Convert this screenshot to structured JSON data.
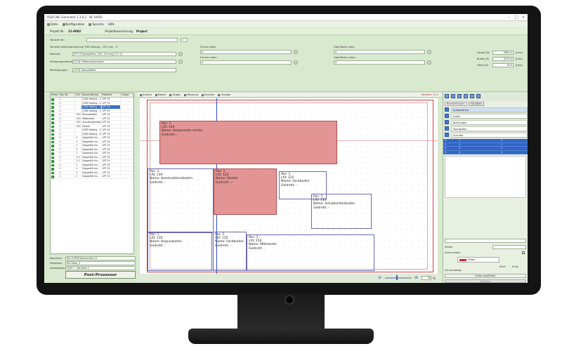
{
  "window": {
    "title": "OSD-CNC-Generator 1.3.0.2 - NC-HOPS"
  },
  "menu": [
    "Datei",
    "Konfiguration",
    "Sprache",
    "Hilfe"
  ],
  "project": {
    "no_label": "Projekt Nr.:",
    "no": "21-0002",
    "name_label": "Projektbezeichnung:",
    "name": "Project"
  },
  "form": {
    "variant_label": "Variante Nr.:",
    "variant_value": "1",
    "description": "Variante Außenabmessung: OSD Vesting - 19-0 mm - 4",
    "material_label": "Material:",
    "material": "[FP 19 Spanplatte, V20, 19 mm] [3 x 2]",
    "fertigung_label": "Fertigungsmethode:",
    "fertigung": "[110] Plattenmaterialien",
    "rohteil_label": "Rohteilgruppe:",
    "rohteil": "[110] Spanplatten",
    "furnier_oben_label": "Furnier oben:",
    "furnier_oben": "A",
    "furnier_unten_label": "Furnier unten:",
    "furnier_unten": "A",
    "oberflaeche_oben_label": "Oberfläche oben:",
    "oberflaeche_oben": "A",
    "oberflaeche_unten_label": "Oberfläche unten:",
    "oberflaeche_unten": "A",
    "laenge_label": "Länge [X]:",
    "laenge": "2890.0",
    "laenge_unit": "[mm]",
    "breite_label": "Breite [Y]:",
    "breite": "2070.0",
    "breite_unit": "[mm]",
    "hoehe_label": "Höhe [Z]:",
    "hoehe": "19.0",
    "hoehe_unit": "[mm]"
  },
  "parts_table": {
    "columns": [
      "Pomo",
      "Pos.-Nr.",
      "Lfd",
      "Beschreibung",
      "Material",
      "Länge"
    ],
    "rows": [
      {
        "pos": "1",
        "lfd": "",
        "desc": "[OSD Vesting - 19...",
        "mat": "LFP 19",
        "sel": false
      },
      {
        "pos": "1",
        "lfd": "",
        "desc": "[OSD Vesting - 19...",
        "mat": "LFP 19",
        "sel": false
      },
      {
        "pos": "1",
        "lfd": "",
        "desc": "[OSD Vesting - 19...",
        "mat": "LFP 19",
        "sel": true
      },
      {
        "pos": "1",
        "lfd": "",
        "desc": "[OSD Vesting - 19...",
        "mat": "LFP 19",
        "sel": false
      },
      {
        "pos": "1",
        "lfd": "120",
        "desc": "Korpusboden",
        "mat": "LFP 19",
        "sel": false
      },
      {
        "pos": "1",
        "lfd": "130",
        "desc": "Mittelseite",
        "mat": "LFP 19",
        "sel": false
      },
      {
        "pos": "1",
        "lfd": "135",
        "desc": "Schubkastenboden",
        "mat": "LFP 19",
        "sel": false
      },
      {
        "pos": "1",
        "lfd": "140",
        "desc": "Deckel",
        "mat": "LFP 19",
        "sel": false
      },
      {
        "pos": "1",
        "lfd": "",
        "desc": "[OSD Vesting - 19...",
        "mat": "LFP 19",
        "sel": false
      },
      {
        "pos": "1",
        "lfd": "",
        "desc": "[OSD Vesting - 19...",
        "mat": "LFP 19",
        "sel": false
      },
      {
        "pos": "1",
        "lfd": "1",
        "desc": "Doppeltür Ins...",
        "mat": "LFP 19",
        "sel": false
      },
      {
        "pos": "1",
        "lfd": "1",
        "desc": "Doppeltür Ins...",
        "mat": "LFP 19",
        "sel": false
      },
      {
        "pos": "1",
        "lfd": "1",
        "desc": "Doppeltür Ins...",
        "mat": "LFP 19",
        "sel": false
      },
      {
        "pos": "1",
        "lfd": "1",
        "desc": "Doppeltür Ins...",
        "mat": "LFP 19",
        "sel": false
      },
      {
        "pos": "1",
        "lfd": "1",
        "desc": "Doppeltür Ins...",
        "mat": "LFP 19",
        "sel": false
      },
      {
        "pos": "1",
        "lfd": "1.1",
        "desc": "Doppeltür Ins...",
        "mat": "LFP 19",
        "sel": false
      },
      {
        "pos": "1",
        "lfd": "1.1",
        "desc": "Doppeltür Ins...",
        "mat": "LFP 19",
        "sel": false
      },
      {
        "pos": "1",
        "lfd": "1",
        "desc": "Doppeltür Ins...",
        "mat": "LFP 19",
        "sel": false
      },
      {
        "pos": "1",
        "lfd": "1",
        "desc": "Doppeltür Ins...",
        "mat": "LFP 19",
        "sel": false
      },
      {
        "pos": "1",
        "lfd": "1",
        "desc": "Doppeltür Ins...",
        "mat": "LFP 19",
        "sel": false
      },
      {
        "pos": "1",
        "lfd": "1",
        "desc": "Doppeltür Ins...",
        "mat": "LFP 19",
        "sel": false
      }
    ]
  },
  "bottom": {
    "maschine_label": "Maschine:",
    "maschine": "NC-HOPS/Heinzmühle 21",
    "prozessor_label": "Prozessor:",
    "prozessor": "NC-Hops_3",
    "arbeitsplatz_label": "Arbeitsplatz:",
    "arbeitsplatz": "Feld 1 - Variante 1",
    "post_button": "Post-Prozessor"
  },
  "toolbar": [
    "Ansicht",
    "Raster",
    "Zeigen",
    "Messung",
    "Drucken",
    "Anzeige"
  ],
  "canvas": {
    "status": "Gedreht: 10.4",
    "parts": [
      {
        "pos": "Pos: 1",
        "lfd": "Lfd: 140",
        "name": "Name: Korpusseite rechts",
        "gedreht": "Gedreht: -",
        "hl": true
      },
      {
        "pos": "Pos: 1",
        "lfd": "Lfd: 130",
        "name": "Name: Konstruktionsboden",
        "gedreht": "Gedreht: -",
        "hl": false
      },
      {
        "pos": "Pos: 1",
        "lfd": "Lfd: 120",
        "name": "Name: Deckel",
        "gedreht": "Gedreht: ✓",
        "hl": true
      },
      {
        "pos": "Pos: 1",
        "lfd": "Lfd: 125",
        "name": "Name: Fachboden",
        "gedreht": "Gedreht: -",
        "hl": false
      },
      {
        "pos": "Pos: 1",
        "lfd": "Lfd: 135",
        "name": "Name: Schubkastenboden",
        "gedreht": "Gedreht: -",
        "hl": false
      },
      {
        "pos": "Pos: 1",
        "lfd": "Lfd: 135",
        "name": "Name: Korpusboden",
        "gedreht": "Gedreht: -",
        "hl": false
      },
      {
        "pos": "Pos: 1",
        "lfd": "Lfd: 125",
        "name": "Name: Fachboden",
        "gedreht": "Gedreht: -",
        "hl": false
      },
      {
        "pos": "Pos: 1",
        "lfd": "Lfd: 150",
        "name": "Name: Mittelseite",
        "gedreht": "Gedreht: -",
        "hl": false
      }
    ],
    "zoom": "30"
  },
  "right": {
    "tabs": [
      "Bearbeitungen",
      "Variablen"
    ],
    "items": [
      "Außenkontur",
      "Nuten",
      "Bohrungen",
      "Abzugsbau",
      "Schnitte"
    ],
    "rows": [
      {
        "a": "1",
        "b": "1"
      },
      {
        "a": "2",
        "b": "1"
      },
      {
        "a": "3",
        "b": "1"
      },
      {
        "a": "4",
        "b": "1"
      }
    ],
    "staerke_label": "Stärke",
    "abschneiden_label": "Abschneiden",
    "fraeser_label": "Fräser",
    "vorschub_label": "Vorschubweg",
    "start_label": "Start",
    "ende_label": "Ende",
    "apply_label": "Ecken ausführen",
    "erstellen_label": "Erstellen"
  }
}
